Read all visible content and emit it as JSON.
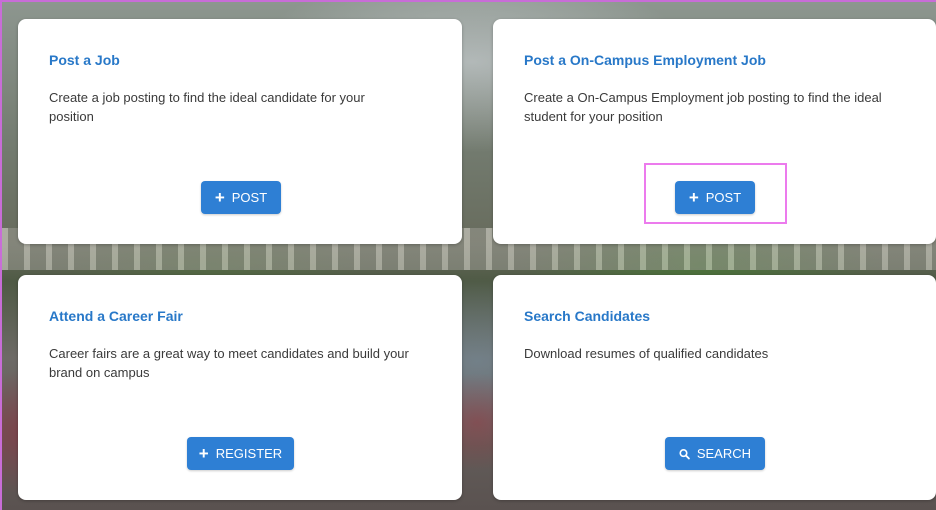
{
  "cards": [
    {
      "title": "Post a Job",
      "description": "Create a job posting to find the ideal candidate for your position",
      "button_label": "POST",
      "button_icon": "plus-icon"
    },
    {
      "title": "Post a On-Campus Employment Job",
      "description": "Create a On-Campus Employment job posting to find the ideal student for your position",
      "button_label": "POST",
      "button_icon": "plus-icon"
    },
    {
      "title": "Attend a Career Fair",
      "description": "Career fairs are a great way to meet candidates and build your brand on campus",
      "button_label": "REGISTER",
      "button_icon": "plus-icon"
    },
    {
      "title": "Search Candidates",
      "description": "Download resumes of qualified candidates",
      "button_label": "SEARCH",
      "button_icon": "search-icon"
    }
  ],
  "colors": {
    "title": "#2878c8",
    "button": "#2e7fd4",
    "highlight": "#ec7bed",
    "frame_border": "#c86dd7"
  }
}
